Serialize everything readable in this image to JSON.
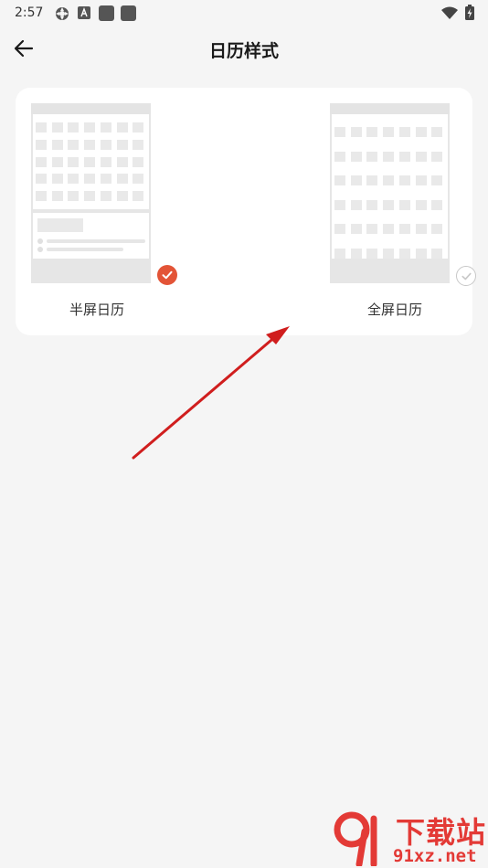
{
  "status_bar": {
    "time": "2:57",
    "left_icons": [
      "settings-gear-icon",
      "a-badge-icon",
      "app-square-icon",
      "app-square-icon"
    ],
    "right_icons": [
      "wifi-icon",
      "battery-charging-icon"
    ]
  },
  "app_bar": {
    "back_icon": "arrow-left-icon",
    "title": "日历样式"
  },
  "options": [
    {
      "label": "半屏日历",
      "selected": true
    },
    {
      "label": "全屏日历",
      "selected": false
    }
  ],
  "colors": {
    "accent": "#e35437",
    "annotation_arrow": "#d01e1e",
    "background": "#f5f5f5",
    "card": "#ffffff"
  },
  "watermark": {
    "line1": "下载站",
    "line2": "91xz.net"
  }
}
